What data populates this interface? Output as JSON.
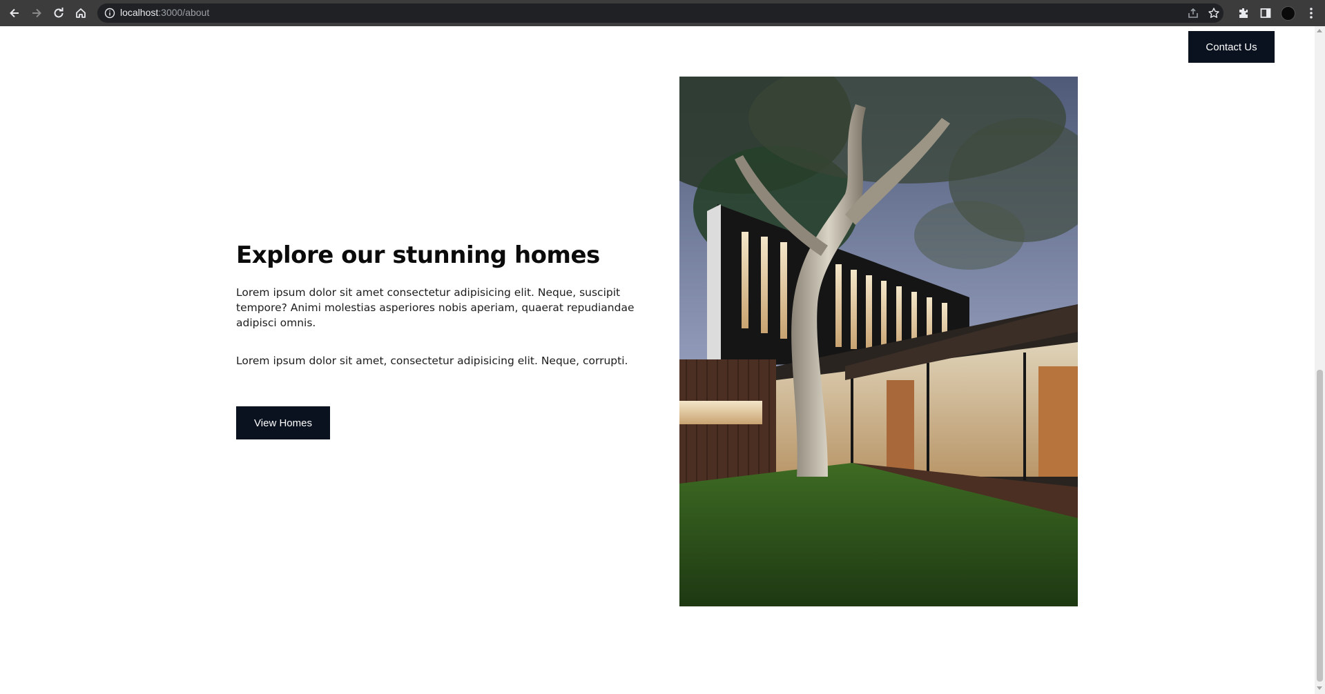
{
  "browser": {
    "url_host": "localhost",
    "url_path": ":3000/about",
    "icons": [
      "back-arrow-icon",
      "forward-arrow-icon",
      "reload-icon",
      "home-icon",
      "info-icon",
      "share-icon",
      "star-icon",
      "extensions-icon",
      "side-panel-icon",
      "avatar",
      "menu-icon"
    ]
  },
  "header": {
    "contact_label": "Contact Us"
  },
  "hero": {
    "title": "Explore our stunning homes",
    "paragraph_1": "Lorem ipsum dolor sit amet consectetur adipisicing elit. Neque, suscipit tempore? Animi molestias asperiores nobis aperiam, quaerat repudiandae adipisci omnis.",
    "paragraph_2": "Lorem ipsum dolor sit amet, consectetur adipisicing elit. Neque, corrupti.",
    "button_label": "View Homes"
  },
  "colors": {
    "chrome": "#3c3c3c",
    "button_bg": "#0a1220",
    "page_bg": "#ffffff"
  }
}
